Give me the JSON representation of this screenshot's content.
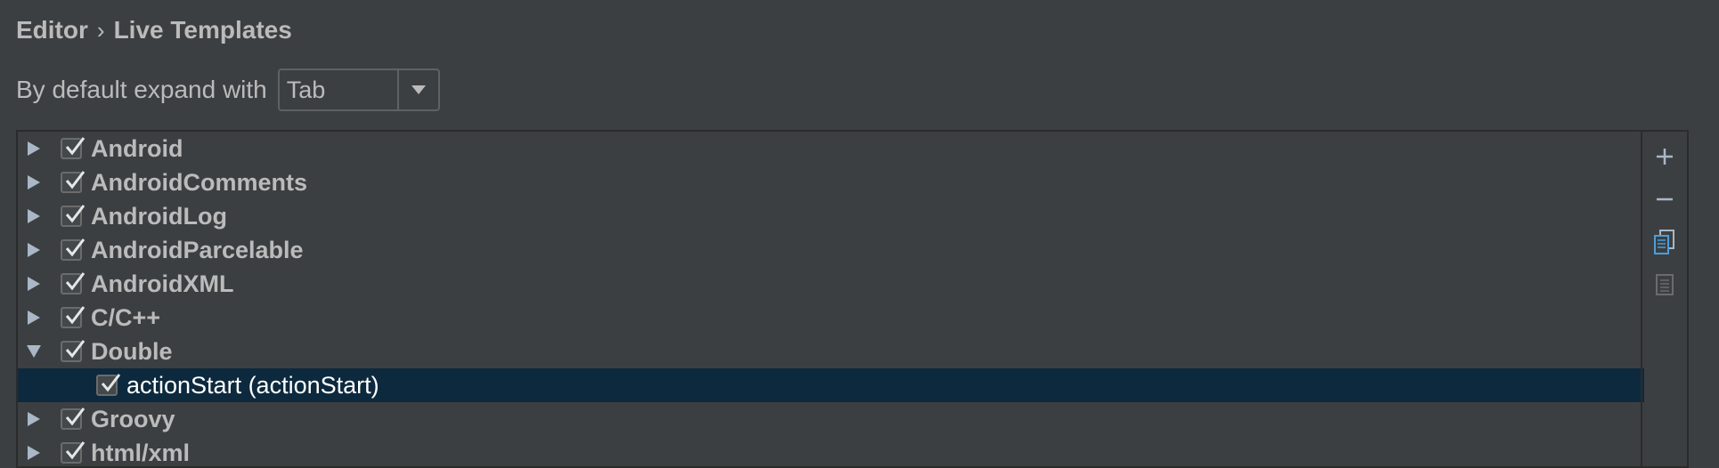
{
  "breadcrumb": {
    "parent": "Editor",
    "separator": "›",
    "current": "Live Templates"
  },
  "expand": {
    "label": "By default expand with",
    "value": "Tab"
  },
  "tree": {
    "groups": [
      {
        "label": "Android",
        "checked": true,
        "expanded": false
      },
      {
        "label": "AndroidComments",
        "checked": true,
        "expanded": false
      },
      {
        "label": "AndroidLog",
        "checked": true,
        "expanded": false
      },
      {
        "label": "AndroidParcelable",
        "checked": true,
        "expanded": false
      },
      {
        "label": "AndroidXML",
        "checked": true,
        "expanded": false
      },
      {
        "label": "C/C++",
        "checked": true,
        "expanded": false
      },
      {
        "label": "Double",
        "checked": true,
        "expanded": true
      },
      {
        "label": "Groovy",
        "checked": true,
        "expanded": false
      },
      {
        "label": "html/xml",
        "checked": true,
        "expanded": false
      }
    ],
    "child": {
      "label": "actionStart (actionStart)",
      "checked": true,
      "selected": true
    }
  },
  "toolbar": {
    "add_icon": "plus-icon",
    "remove_icon": "minus-icon",
    "copy_icon": "copy-icon",
    "restore_icon": "restore-defaults-icon"
  },
  "colors": {
    "background": "#3c3f41",
    "selection": "#0d293e",
    "text": "#bbbbbb",
    "accent": "#4a9ede"
  }
}
